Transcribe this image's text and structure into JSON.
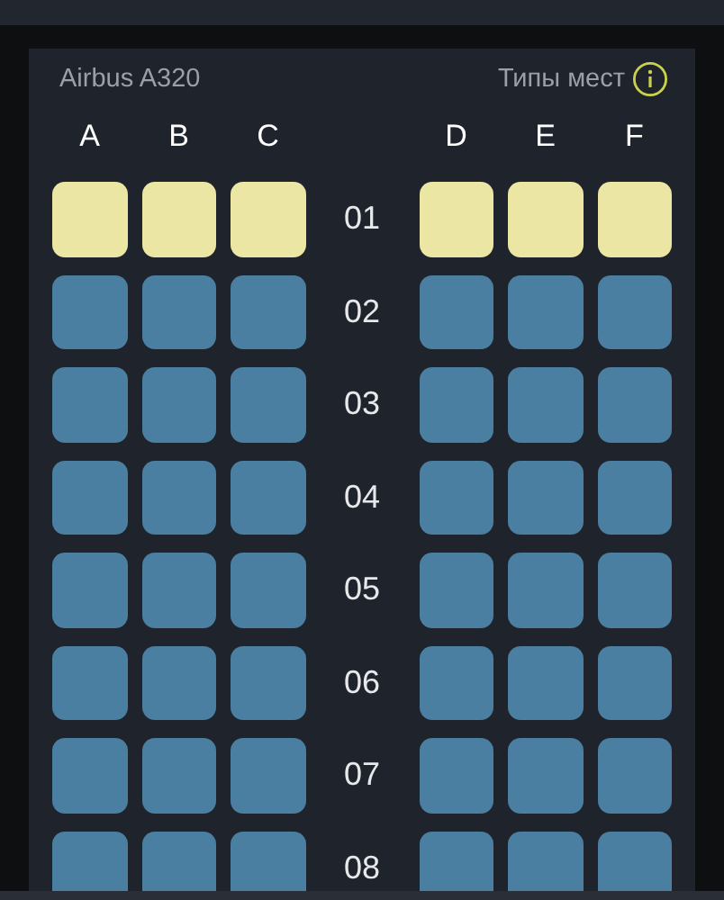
{
  "aircraft": "Airbus A320",
  "seat_types_link": "Типы мест",
  "columns": [
    "A",
    "B",
    "C",
    "D",
    "E",
    "F"
  ],
  "rows": [
    {
      "number": "01",
      "kind": "premium"
    },
    {
      "number": "02",
      "kind": "standard"
    },
    {
      "number": "03",
      "kind": "standard"
    },
    {
      "number": "04",
      "kind": "standard"
    },
    {
      "number": "05",
      "kind": "standard"
    },
    {
      "number": "06",
      "kind": "standard"
    },
    {
      "number": "07",
      "kind": "standard"
    },
    {
      "number": "08",
      "kind": "standard"
    }
  ]
}
